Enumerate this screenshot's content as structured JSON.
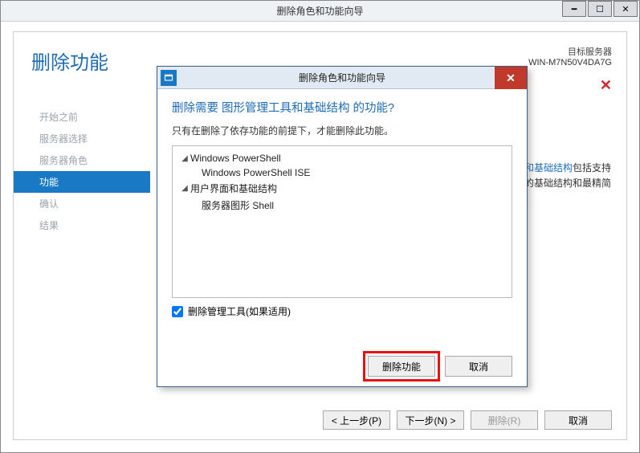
{
  "outer": {
    "title": "删除角色和功能向导",
    "page_title": "删除功能",
    "target_label": "目标服务器",
    "target_server": "WIN-M7N50V4DA7G",
    "sidebar": [
      {
        "label": "开始之前"
      },
      {
        "label": "服务器选择"
      },
      {
        "label": "服务器角色"
      },
      {
        "label": "功能"
      },
      {
        "label": "确认"
      },
      {
        "label": "结果"
      }
    ],
    "active_index": 3,
    "right_text_link": "理工具和基础结构",
    "right_text_rest": "包括支持理工具的基础结构和最精简的界面。",
    "buttons": {
      "prev": "< 上一步(P)",
      "next": "下一步(N) >",
      "remove": "删除(R)",
      "cancel": "取消"
    }
  },
  "dialog": {
    "title": "删除角色和功能向导",
    "question": "删除需要 图形管理工具和基础结构 的功能?",
    "desc": "只有在删除了依存功能的前提下，才能删除此功能。",
    "tree": [
      {
        "label": "Windows PowerShell",
        "children": [
          {
            "label": "Windows PowerShell ISE"
          }
        ]
      },
      {
        "label": "用户界面和基础结构",
        "children": [
          {
            "label": "服务器图形 Shell"
          }
        ]
      }
    ],
    "checkbox_label": "删除管理工具(如果适用)",
    "checkbox_checked": true,
    "buttons": {
      "remove": "删除功能",
      "cancel": "取消"
    }
  }
}
